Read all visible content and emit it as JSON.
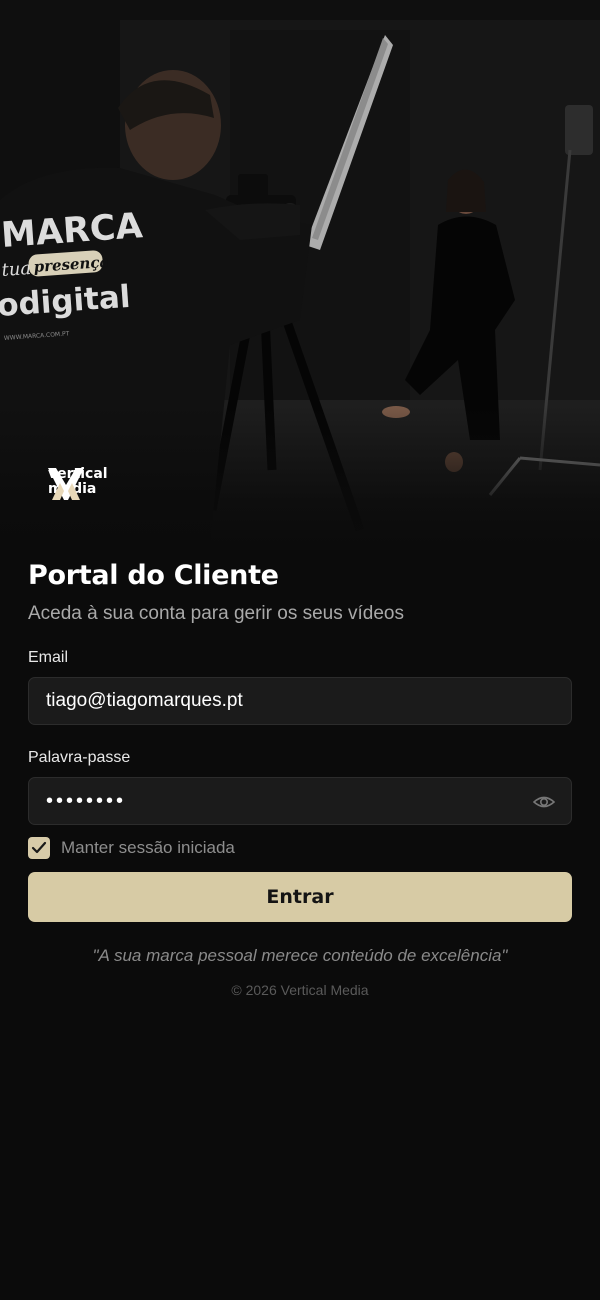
{
  "hero": {
    "shirt_line1": "MARCA",
    "shirt_line2a": "tua",
    "shirt_line2b": "presença",
    "shirt_line3": "odigital",
    "shirt_small": "WWW.MARCA.COM.PT"
  },
  "brand": {
    "name_line1": "vertical",
    "name_line2": "media",
    "logo_icon": "vm-monogram-icon"
  },
  "login": {
    "title": "Portal do Cliente",
    "subtitle": "Aceda à sua conta para gerir os seus vídeos",
    "email_label": "Email",
    "email_value": "tiago@tiagomarques.pt",
    "password_label": "Palavra-passe",
    "password_value": "••••••••",
    "password_toggle_icon": "eye-icon",
    "remember_label": "Manter sessão iniciada",
    "remember_checked": true,
    "submit_label": "Entrar"
  },
  "quote": "\"A sua marca pessoal merece conteúdo de excelência\"",
  "footer": "© 2026 Vertical Media",
  "colors": {
    "background": "#0b0b0b",
    "accent": "#d7cba5",
    "input_bg": "#1b1b1b"
  }
}
